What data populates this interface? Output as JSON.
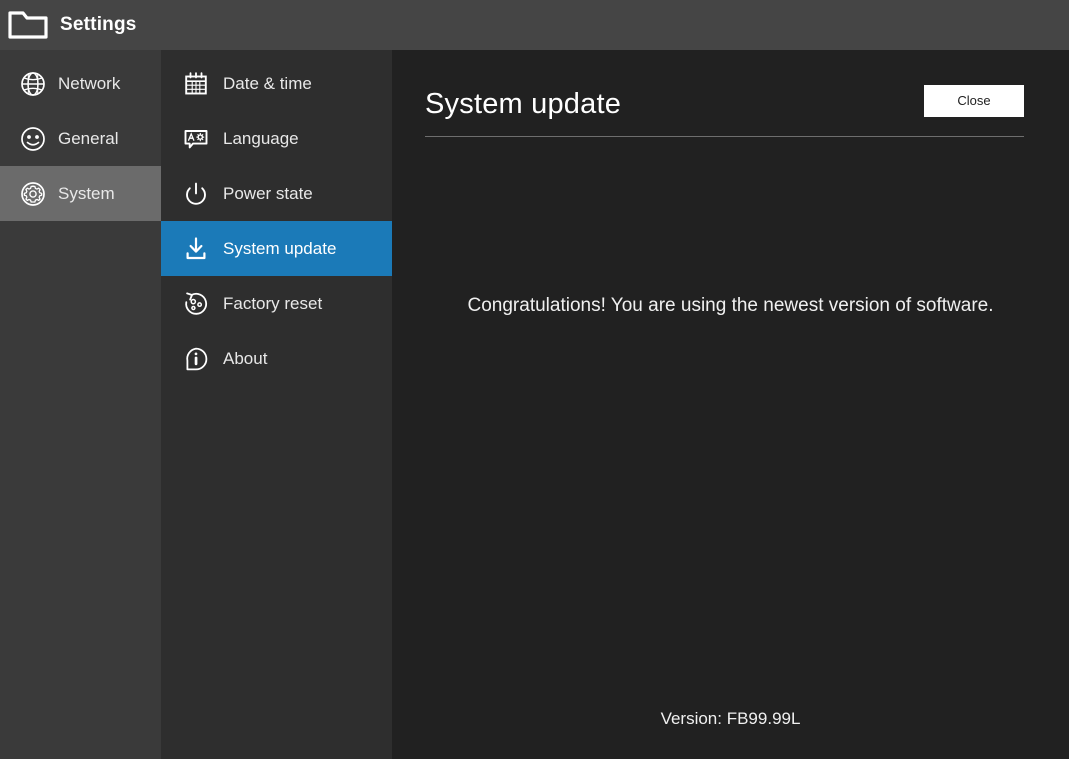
{
  "titlebar": {
    "icon": "folder-icon",
    "title": "Settings"
  },
  "sidebar": {
    "items": [
      {
        "label": "Network",
        "icon": "globe-icon",
        "selected": false
      },
      {
        "label": "General",
        "icon": "face-icon",
        "selected": false
      },
      {
        "label": "System",
        "icon": "gear-icon",
        "selected": true
      }
    ]
  },
  "submenu": {
    "items": [
      {
        "label": "Date & time",
        "icon": "calendar-icon",
        "selected": false
      },
      {
        "label": "Language",
        "icon": "translate-icon",
        "selected": false
      },
      {
        "label": "Power state",
        "icon": "power-icon",
        "selected": false
      },
      {
        "label": "System update",
        "icon": "download-icon",
        "selected": true
      },
      {
        "label": "Factory reset",
        "icon": "reset-icon",
        "selected": false
      },
      {
        "label": "About",
        "icon": "info-icon",
        "selected": false
      }
    ]
  },
  "content": {
    "title": "System update",
    "close_label": "Close",
    "message": "Congratulations! You are using the newest version of software.",
    "version": "Version: FB99.99L"
  },
  "colors": {
    "titlebar_bg": "#454545",
    "sidebar_bg": "#3a3a3a",
    "sidebar_selected_bg": "#6b6b6b",
    "submenu_bg": "#2e2e2e",
    "submenu_selected_bg": "#1b7ab8",
    "content_bg": "#212121",
    "text": "#ffffff",
    "button_bg": "#ffffff",
    "button_text": "#1e1e1e",
    "divider": "#6e6e6e"
  }
}
